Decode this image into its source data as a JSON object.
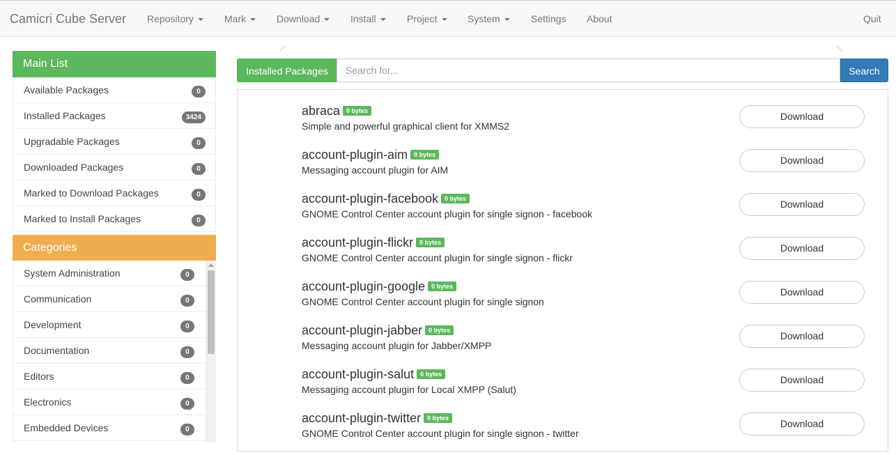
{
  "nav": {
    "brand": "Camicri Cube Server",
    "menus": [
      {
        "label": "Repository",
        "dropdown": true
      },
      {
        "label": "Mark",
        "dropdown": true
      },
      {
        "label": "Download",
        "dropdown": true
      },
      {
        "label": "Install",
        "dropdown": true
      },
      {
        "label": "Project",
        "dropdown": true
      },
      {
        "label": "System",
        "dropdown": true
      },
      {
        "label": "Settings",
        "dropdown": false
      },
      {
        "label": "About",
        "dropdown": false
      }
    ],
    "quit": "Quit"
  },
  "sidebar": {
    "main_title": "Main List",
    "main_items": [
      {
        "label": "Available Packages",
        "count": "0"
      },
      {
        "label": "Installed Packages",
        "count": "3424"
      },
      {
        "label": "Upgradable Packages",
        "count": "0"
      },
      {
        "label": "Downloaded Packages",
        "count": "0"
      },
      {
        "label": "Marked to Download Packages",
        "count": "0"
      },
      {
        "label": "Marked to Install Packages",
        "count": "0"
      }
    ],
    "categories_title": "Categories",
    "categories": [
      {
        "label": "System Administration",
        "count": "0"
      },
      {
        "label": "Communication",
        "count": "0"
      },
      {
        "label": "Development",
        "count": "0"
      },
      {
        "label": "Documentation",
        "count": "0"
      },
      {
        "label": "Editors",
        "count": "0"
      },
      {
        "label": "Electronics",
        "count": "0"
      },
      {
        "label": "Embedded Devices",
        "count": "0"
      }
    ]
  },
  "search": {
    "scope_label": "Installed Packages",
    "placeholder": "Search for...",
    "value": "",
    "button_label": "Search"
  },
  "packages": [
    {
      "name": "abraca",
      "size": "0 bytes",
      "description": "Simple and powerful graphical client for XMMS2",
      "action": "Download"
    },
    {
      "name": "account-plugin-aim",
      "size": "0 bytes",
      "description": "Messaging account plugin for AIM",
      "action": "Download"
    },
    {
      "name": "account-plugin-facebook",
      "size": "0 bytes",
      "description": "GNOME Control Center account plugin for single signon - facebook",
      "action": "Download"
    },
    {
      "name": "account-plugin-flickr",
      "size": "0 bytes",
      "description": "GNOME Control Center account plugin for single signon - flickr",
      "action": "Download"
    },
    {
      "name": "account-plugin-google",
      "size": "0 bytes",
      "description": "GNOME Control Center account plugin for single signon",
      "action": "Download"
    },
    {
      "name": "account-plugin-jabber",
      "size": "0 bytes",
      "description": "Messaging account plugin for Jabber/XMPP",
      "action": "Download"
    },
    {
      "name": "account-plugin-salut",
      "size": "0 bytes",
      "description": "Messaging account plugin for Local XMPP (Salut)",
      "action": "Download"
    },
    {
      "name": "account-plugin-twitter",
      "size": "0 bytes",
      "description": "GNOME Control Center account plugin for single signon - twitter",
      "action": "Download"
    }
  ],
  "colors": {
    "main_list_header": "#5cb85c",
    "categories_header": "#f0ad4e",
    "search_button": "#337ab7",
    "badge": "#777777"
  }
}
